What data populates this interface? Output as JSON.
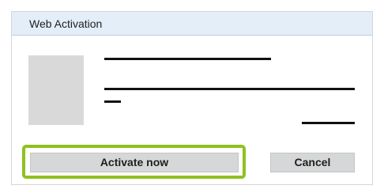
{
  "dialog": {
    "title": "Web Activation",
    "highlight_color": "#8fc11f",
    "titlebar_color": "#e3eef8",
    "image": "image-placeholder"
  },
  "actions": {
    "activate_label": "Activate now",
    "cancel_label": "Cancel"
  }
}
